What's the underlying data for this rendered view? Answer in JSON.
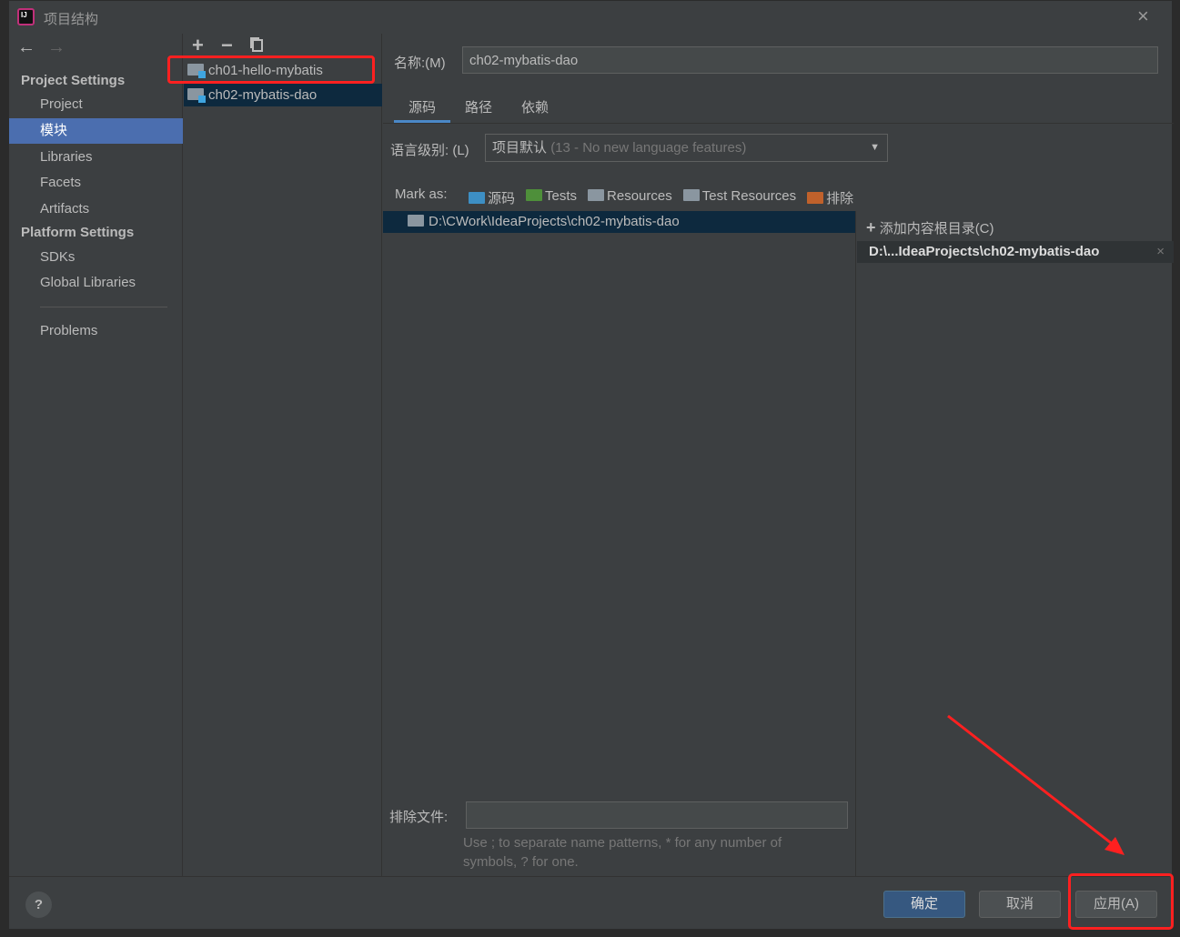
{
  "window": {
    "title": "项目结构",
    "close_icon": "close-icon"
  },
  "nav": {
    "back": "←",
    "forward": "→"
  },
  "sidebar": {
    "project_settings": "Project Settings",
    "items1": [
      "Project",
      "模块",
      "Libraries",
      "Facets",
      "Artifacts"
    ],
    "platform_settings": "Platform Settings",
    "items2": [
      "SDKs",
      "Global Libraries"
    ],
    "problems": "Problems"
  },
  "toolbar": {
    "add": "+",
    "remove": "−",
    "copy": "copy"
  },
  "modules": [
    "ch01-hello-mybatis",
    "ch02-mybatis-dao"
  ],
  "main": {
    "name_label": "名称:(M)",
    "name_value": "ch02-mybatis-dao",
    "tabs": [
      "源码",
      "路径",
      "依赖"
    ],
    "lang_label": "语言级别: (L)",
    "lang_value": "项目默认",
    "lang_hint": "(13 - No new language features)",
    "mark_as": "Mark as:",
    "marks": [
      {
        "label": "源码",
        "color": "#3d8fc4"
      },
      {
        "label": "Tests",
        "color": "#4e8f3a"
      },
      {
        "label": "Resources",
        "color": "#8a96a0"
      },
      {
        "label": "Test Resources",
        "color": "#8a96a0"
      },
      {
        "label": "排除",
        "color": "#c0612b"
      }
    ],
    "content_root": "D:\\CWork\\IdeaProjects\\ch02-mybatis-dao",
    "add_root": "添加内容根目录(C)",
    "root_short": "D:\\...IdeaProjects\\ch02-mybatis-dao",
    "exclude_label": "排除文件:",
    "exclude_value": "",
    "exclude_hint": "Use ; to separate name patterns, * for any number of symbols, ? for one."
  },
  "footer": {
    "help": "?",
    "ok": "确定",
    "cancel": "取消",
    "apply": "应用(A)"
  },
  "colors": {
    "annotation": "#ff2020",
    "selection": "#4b6eaf",
    "tree_selection": "#0d293e",
    "primary_button": "#365880"
  }
}
